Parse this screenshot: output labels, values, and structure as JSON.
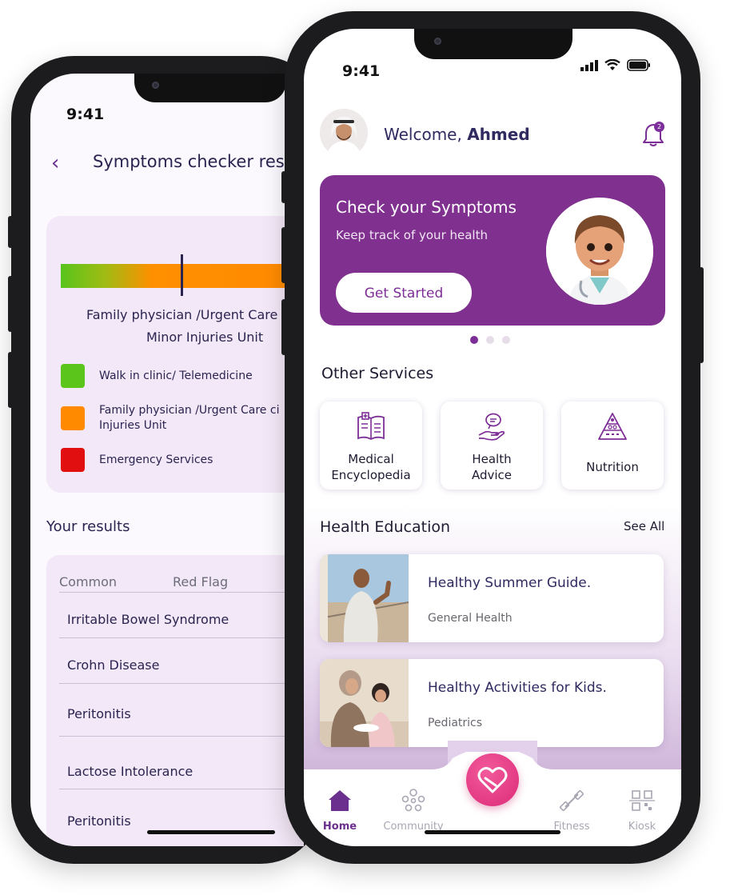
{
  "back_screen": {
    "status_time": "9:41",
    "title": "Symptoms checker res",
    "severity_line1": "Family physician /Urgent Care",
    "severity_line2": "Minor Injuries Unit",
    "legend": [
      {
        "label": "Walk in clinic/ Telemedicine",
        "color": "#5cc51b"
      },
      {
        "label": "Family physician /Urgent Care ci",
        "label_line2": "Injuries Unit",
        "color": "#ff8a00"
      },
      {
        "label": "Emergency Services",
        "color": "#e10f0f"
      }
    ],
    "results_title": "Your results",
    "columns": [
      "Common",
      "Red Flag"
    ],
    "results": [
      "Irritable Bowel Syndrome",
      "Crohn Disease",
      "Peritonitis",
      "Lactose Intolerance",
      "Peritonitis"
    ]
  },
  "front_screen": {
    "status_time": "9:41",
    "welcome_prefix": "Welcome,",
    "user_name": "Ahmed",
    "notification_count": "2",
    "banner": {
      "title": "Check your Symptoms",
      "subtitle": "Keep track of your health",
      "cta": "Get Started"
    },
    "other_services_title": "Other Services",
    "services": [
      {
        "line1": "Medical",
        "line2": "Encyclopedia",
        "icon": "book-icon"
      },
      {
        "line1": "Health",
        "line2": "Advice",
        "icon": "hand-advice-icon"
      },
      {
        "line1": "Nutrition",
        "line2": "",
        "icon": "food-pyramid-icon"
      }
    ],
    "health_education_title": "Health Education",
    "see_all": "See All",
    "articles": [
      {
        "title": "Healthy Summer Guide.",
        "category": "General Health"
      },
      {
        "title": "Healthy Activities for Kids.",
        "category": "Pediatrics"
      }
    ],
    "tabs": [
      {
        "label": "Home",
        "icon": "home-icon",
        "active": true
      },
      {
        "label": "Community",
        "icon": "community-icon",
        "active": false
      },
      {
        "label": "Fitness",
        "icon": "dumbbell-icon",
        "active": false
      },
      {
        "label": "Kiosk",
        "icon": "qr-kiosk-icon",
        "active": false
      }
    ],
    "center_action_icon": "heart-icon"
  },
  "colors": {
    "brand_purple": "#80308f",
    "text_navy": "#2f2a60",
    "accent_pink": "#dc2b78"
  }
}
